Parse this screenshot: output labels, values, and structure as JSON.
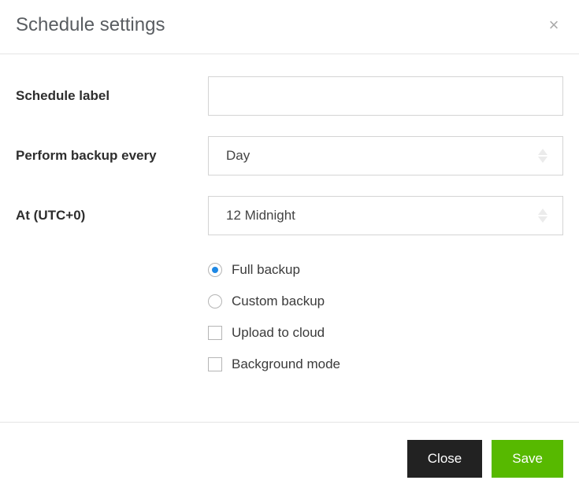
{
  "header": {
    "title": "Schedule settings"
  },
  "form": {
    "schedule_label": {
      "label": "Schedule label",
      "value": ""
    },
    "frequency": {
      "label": "Perform backup every",
      "value": "Day"
    },
    "time": {
      "label": "At (UTC+0)",
      "value": "12 Midnight"
    },
    "backup_type": {
      "full": "Full backup",
      "custom": "Custom backup",
      "selected": "full"
    },
    "upload_cloud": {
      "label": "Upload to cloud",
      "checked": false
    },
    "background_mode": {
      "label": "Background mode",
      "checked": false
    }
  },
  "footer": {
    "close": "Close",
    "save": "Save"
  }
}
